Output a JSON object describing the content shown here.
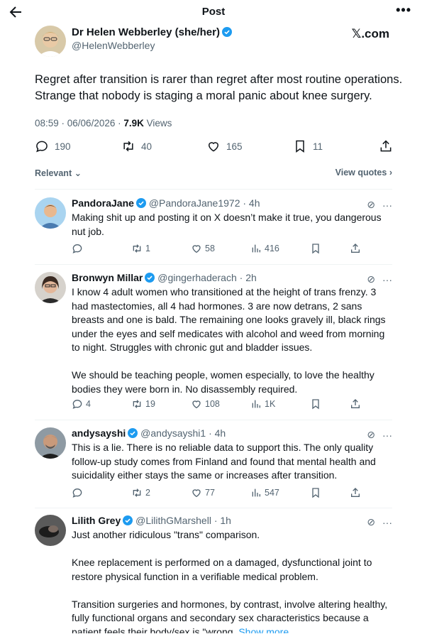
{
  "header": {
    "title": "Post"
  },
  "post": {
    "author_name": "Dr Helen Webberley (she/her)",
    "author_handle": "@HelenWebberley",
    "brand": "𝕏.com",
    "text": "Regret after transition is rarer than regret after most routine operations. Strange that nobody is staging a moral panic about knee surgery.",
    "time_date": "08:59 · 06/06/2026 · ",
    "views_count": "7.9K",
    "views_label": " Views",
    "stats": {
      "replies": "190",
      "reposts": "40",
      "likes": "165",
      "bookmarks": "11"
    }
  },
  "sort": {
    "label": "Relevant",
    "view_quotes": "View quotes"
  },
  "replies": [
    {
      "name": "PandoraJane",
      "handle_time": "@PandoraJane1972 · 4h",
      "paragraphs": [
        "Making shit up and posting it on X doesn’t make it true, you dangerous nut job."
      ],
      "stats": {
        "replies": "",
        "reposts": "1",
        "likes": "58",
        "views": "416"
      }
    },
    {
      "name": "Bronwyn Millar",
      "handle_time": "@gingerhaderach · 2h",
      "paragraphs": [
        "I know 4 adult women who transitioned at the height of trans frenzy. 3 had mastectomies, all 4 had hormones. 3 are now detrans, 2 sans breasts and one is bald. The remaining one looks gravely ill, black rings under the eyes and self medicates with alcohol and weed from morning to night. Struggles with chronic gut and bladder issues.",
        "We should be teaching people, women especially, to love the healthy bodies they were born in. No disassembly required."
      ],
      "stats": {
        "replies": "4",
        "reposts": "19",
        "likes": "108",
        "views": "1K"
      }
    },
    {
      "name": "andysayshi",
      "handle_time": "@andysayshi1 · 4h",
      "paragraphs": [
        "This is a lie. There is no reliable data to support this. The only quality follow-up study comes from Finland and found that mental health and suicidality either stays the same or increases after transition."
      ],
      "stats": {
        "replies": "",
        "reposts": "2",
        "likes": "77",
        "views": "547"
      }
    },
    {
      "name": "Lilith Grey",
      "handle_time": "@LilithGMarshell · 1h",
      "paragraphs": [
        "Just another ridiculous \"trans\" comparison.",
        "Knee replacement is performed on a damaged, dysfunctional joint to restore physical function in a verifiable medical problem.",
        "Transition surgeries and hormones, by contrast, involve altering healthy, fully functional organs and secondary sex characteristics because a patient feels their body/sex is \"wrong."
      ],
      "show_more": "Show more"
    }
  ],
  "colors": {
    "accent": "#1d9bf0",
    "muted": "#536471",
    "text": "#0f1419"
  }
}
